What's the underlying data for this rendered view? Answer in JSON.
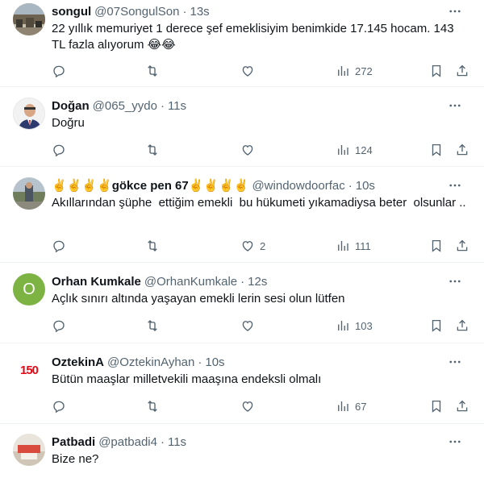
{
  "tweets": [
    {
      "name": "songul",
      "handle": "@07SongulSon",
      "time": "13s",
      "text": "22 yıllık memuriyet 1 derece şef emeklisiyim benimkide 17.145 hocam. 143 TL fazla alıyorum 😂😂",
      "likes": "",
      "views": "272"
    },
    {
      "name": "Doğan",
      "handle": "@065_yydo",
      "time": "11s",
      "text": "Doğru",
      "likes": "",
      "views": "124"
    },
    {
      "name": "✌️✌️✌️✌️gökce pen 67✌️✌️✌️✌️",
      "handle": "@windowdoorfac",
      "time": "10s",
      "text": "Akıllarından şüphe  ettiğim emekli  bu hükumeti yıkamadiysa beter  olsunlar ..",
      "likes": "2",
      "views": "111"
    },
    {
      "name": "Orhan Kumkale",
      "handle": "@OrhanKumkale",
      "time": "12s",
      "text": "Açlık sınırı altında yaşayan emekli lerin sesi olun lütfen",
      "likes": "",
      "views": "103",
      "avatar_letter": "O"
    },
    {
      "name": "OztekinA",
      "handle": "@OztekinAyhan",
      "time": "10s",
      "text": "Bütün maaşlar milletvekili maaşına endeksli olmalı",
      "likes": "",
      "views": "67",
      "avatar_text": "150"
    },
    {
      "name": "Patbadi",
      "handle": "@patbadi4",
      "time": "11s",
      "text": "Bize ne?",
      "likes": "",
      "views": ""
    }
  ],
  "separator": "·",
  "colors": {
    "text": "#0f1419",
    "secondary": "#536471",
    "border": "#eff3f4",
    "avatar_green": "#7cb342",
    "flag_red": "#e30a17"
  },
  "icons": [
    "reply-icon",
    "retweet-icon",
    "like-icon",
    "views-icon",
    "bookmark-icon",
    "share-icon",
    "more-icon"
  ]
}
